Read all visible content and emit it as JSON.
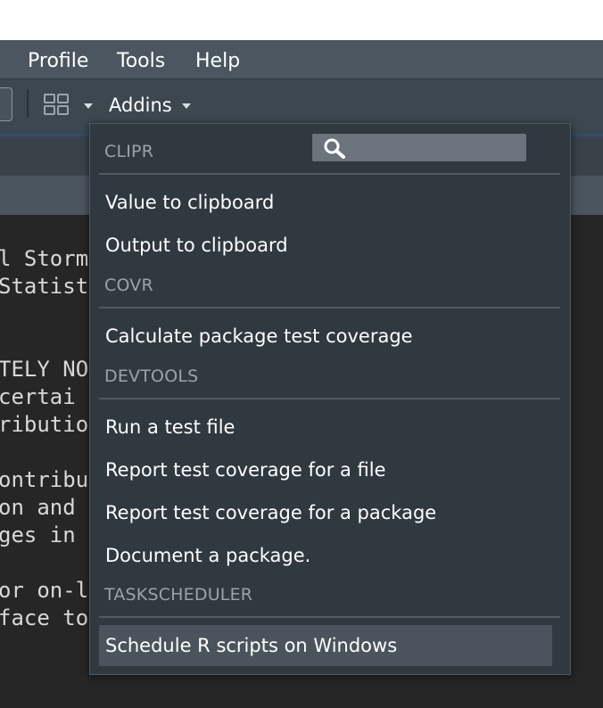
{
  "menubar": {
    "items": [
      {
        "label": "Profile"
      },
      {
        "label": "Tools"
      },
      {
        "label": "Help"
      }
    ]
  },
  "toolbar": {
    "addins_label": "Addins"
  },
  "editor": {
    "lines": [
      "l Storm",
      "Statist",
      "",
      "",
      "TELY NO",
      "certai",
      "ributio",
      "",
      "ontribu",
      "on and",
      "ges in",
      "",
      "or on-l",
      "face to"
    ]
  },
  "addins_menu": {
    "search": {
      "placeholder": ""
    },
    "sections": [
      {
        "header": "CLIPR",
        "items": [
          "Value to clipboard",
          "Output to clipboard"
        ]
      },
      {
        "header": "COVR",
        "items": [
          "Calculate package test coverage"
        ]
      },
      {
        "header": "DEVTOOLS",
        "items": [
          "Run a test file",
          "Report test coverage for a file",
          "Report test coverage for a package",
          "Document a package."
        ]
      },
      {
        "header": "TASKSCHEDULER",
        "items": [
          "Schedule R scripts on Windows"
        ]
      }
    ],
    "selected_item": "Schedule R scripts on Windows"
  },
  "colors": {
    "menubar_bg": "#4b5660",
    "toolbar_bg": "#3c4750",
    "dropdown_bg": "#303840",
    "selected_bg": "#4b545c",
    "editor_bg": "#262626"
  }
}
